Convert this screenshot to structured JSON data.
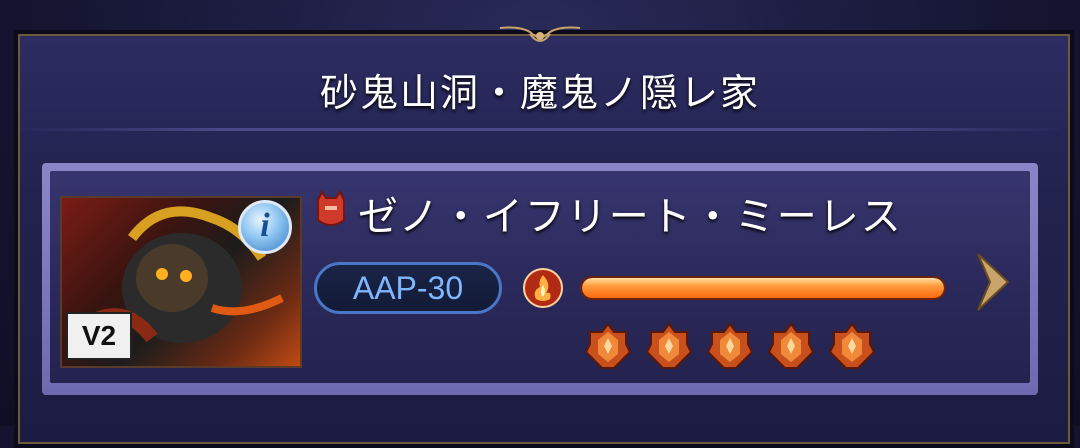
{
  "title": "砂鬼山洞・魔鬼ノ隠レ家",
  "boss": {
    "name": "ゼノ・イフリート・ミーレス",
    "version_badge": "V2",
    "info_label": "i",
    "aap": "AAP-30",
    "element": "fire-icon",
    "hp_percent": 100,
    "difficulty_stars": 5
  },
  "colors": {
    "accent_blue": "#7fb6ff",
    "hp_orange": "#ff7a20"
  }
}
